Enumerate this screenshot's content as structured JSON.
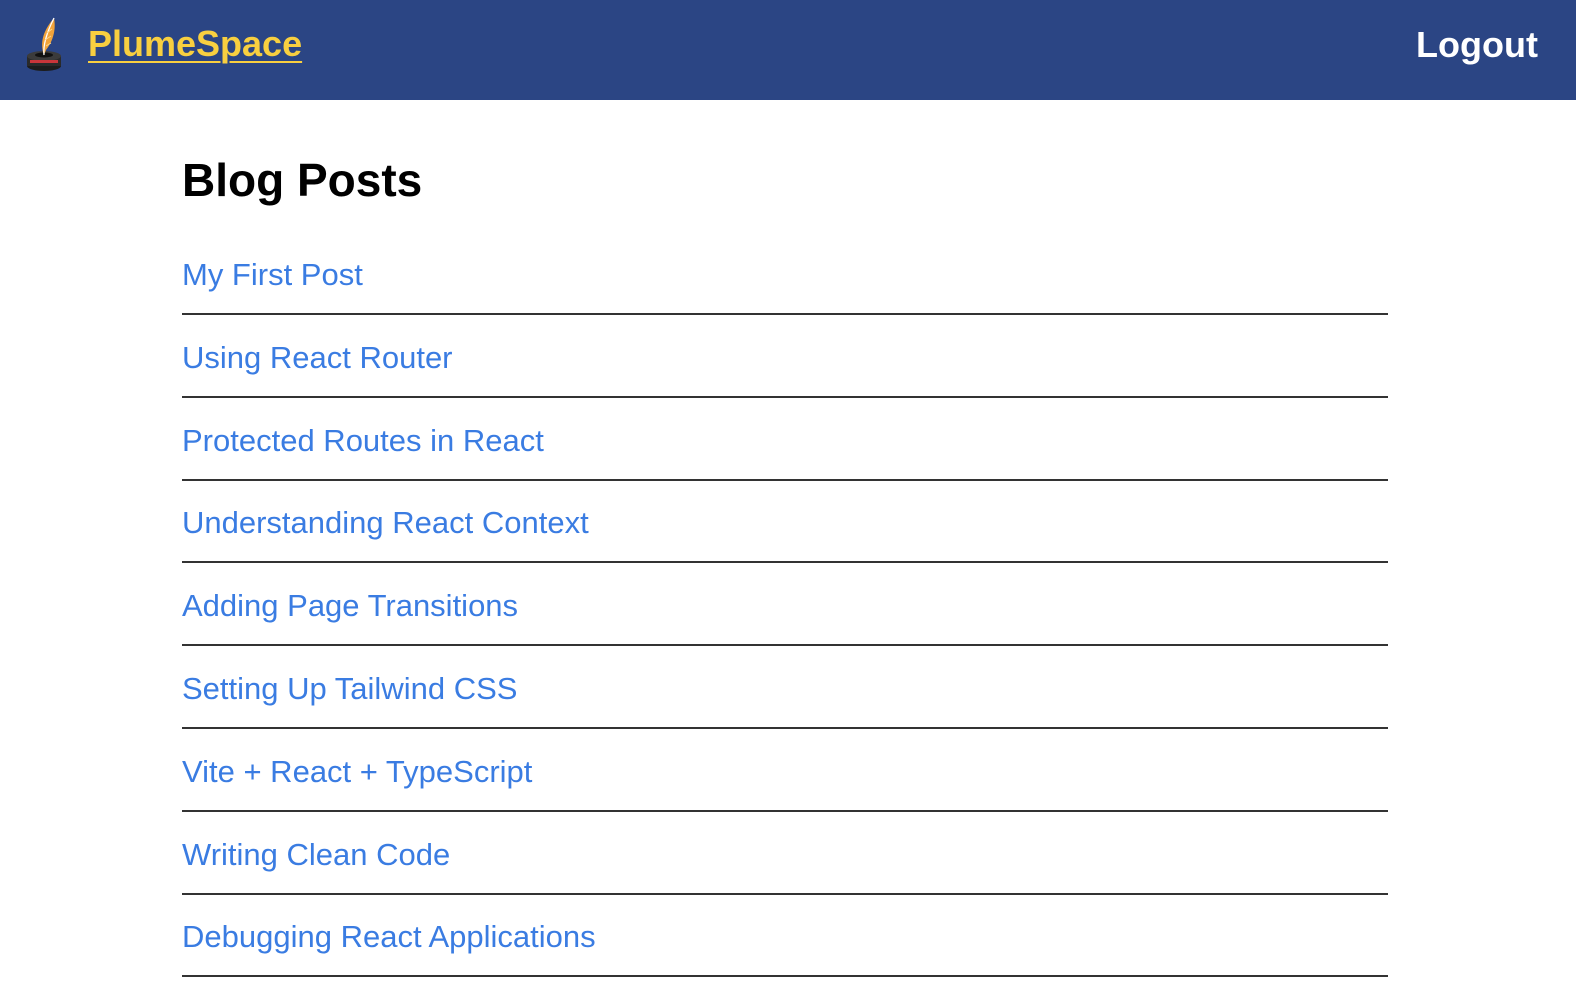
{
  "navbar": {
    "brand_name": "PlumeSpace",
    "logo_icon": "quill-inkwell-icon",
    "logout_label": "Logout",
    "colors": {
      "background": "#2b4584",
      "brand": "#f8cf40",
      "logout": "#ffffff"
    }
  },
  "main": {
    "title": "Blog Posts",
    "link_color": "#3a7ce2",
    "posts": [
      {
        "title": "My First Post"
      },
      {
        "title": "Using React Router"
      },
      {
        "title": "Protected Routes in React"
      },
      {
        "title": "Understanding React Context"
      },
      {
        "title": "Adding Page Transitions"
      },
      {
        "title": "Setting Up Tailwind CSS"
      },
      {
        "title": "Vite + React + TypeScript"
      },
      {
        "title": "Writing Clean Code"
      },
      {
        "title": "Debugging React Applications"
      }
    ]
  }
}
